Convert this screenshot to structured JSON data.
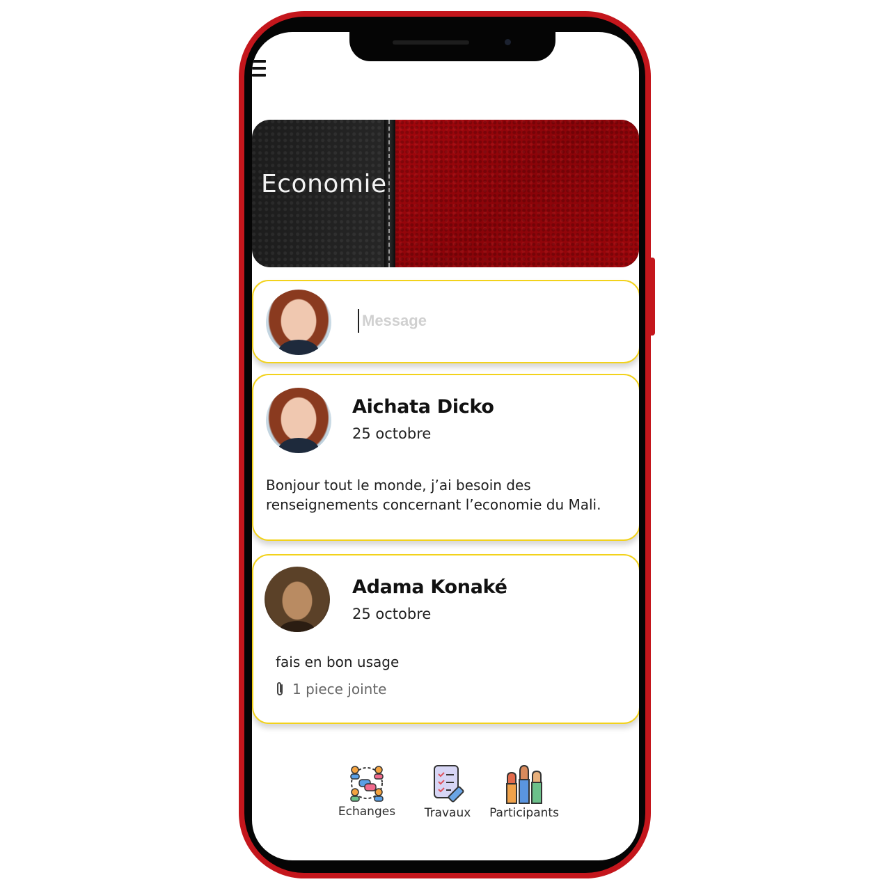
{
  "course": {
    "title": "Economie"
  },
  "compose": {
    "placeholder": "Message"
  },
  "posts": [
    {
      "author": "Aichata Dicko",
      "date": "25 octobre",
      "line1": "Bonjour tout le monde, j’ai besoin des",
      "line2": "renseignements concernant l’economie du Mali."
    },
    {
      "author": "Adama Konaké",
      "date": "25 octobre",
      "line1": "fais en bon usage",
      "attachment": "1 piece jointe"
    }
  ],
  "tabs": [
    {
      "label": "Echanges",
      "icon": "exchange-icon"
    },
    {
      "label": "Travaux",
      "icon": "tasks-icon"
    },
    {
      "label": "Participants",
      "icon": "participants-icon"
    }
  ],
  "colors": {
    "frame": "#c4161c",
    "card_border": "#f2d21b",
    "banner_red": "#9c060b"
  }
}
